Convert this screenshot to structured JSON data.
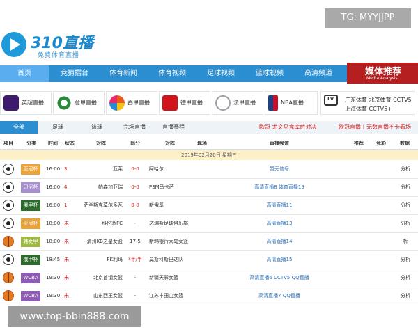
{
  "watermarks": {
    "top": "TG: MYYJJPP",
    "bottom": "www.top-bbin888.com"
  },
  "logo": {
    "title": "310直播",
    "subtitle": "免费体育直播"
  },
  "nav": {
    "items": [
      "首页",
      "竞猜擂台",
      "体育新闻",
      "体育视频",
      "足球视频",
      "篮球视频",
      "高清频道"
    ],
    "badge_title": "媒体推荐",
    "badge_sub": "Media Analysis"
  },
  "leagues": [
    {
      "label": "英超直播",
      "icon": "premier-league-icon",
      "color": "#3d1a6e"
    },
    {
      "label": "意甲直播",
      "icon": "serie-a-icon",
      "color": "#2a8a3a"
    },
    {
      "label": "西甲直播",
      "icon": "laliga-icon",
      "color": "#e85a1a"
    },
    {
      "label": "德甲直播",
      "icon": "bundesliga-icon",
      "color": "#d0141e"
    },
    {
      "label": "法甲直播",
      "icon": "ligue1-icon",
      "color": "#9aa0a6"
    },
    {
      "label": "NBA直播",
      "icon": "nba-icon",
      "color": "#1d428a"
    }
  ],
  "tv": {
    "icon_text": "TV",
    "line1": "广东体育 北京体育 CCTV5",
    "line2": "上海体育 CCTV5+"
  },
  "tabs": [
    "全部",
    "足球",
    "篮球",
    "完场直播",
    "直播赛程"
  ],
  "notices": [
    "欧冠 尤文马竞库萨对决",
    "欧冠直播丨无数直播不卡看场"
  ],
  "headers": [
    "项目",
    "分类",
    "时间",
    "状态",
    "对阵",
    "比分",
    "对阵",
    "现场",
    "直播频道",
    "推荐",
    "竞彩",
    "数据"
  ],
  "date_row": "2019年02月20日 星期三",
  "rows": [
    {
      "sport": "soccer",
      "league": "亚冠杯",
      "league_color": "#e8a33a",
      "time": "16:00",
      "status": "3'",
      "home": "亚莱",
      "score": "0-0",
      "away": "阿哈尔",
      "half": "",
      "channels": "暂无信号",
      "data": "分析"
    },
    {
      "sport": "soccer",
      "league": "印尼杯",
      "league_color": "#a78fd0",
      "time": "16:00",
      "status": "4'",
      "home": "帕森加亚瑞",
      "score": "0-0",
      "away": "PSM马卡萨",
      "half": "",
      "channels": "高清直播8  体育直播19",
      "data": "分析"
    },
    {
      "sport": "soccer",
      "league": "俄甲杯",
      "league_color": "#2d6b2d",
      "time": "16:00",
      "status": "1'",
      "home": "萨兰斯克莫尔多瓦",
      "score": "0-0",
      "away": "新俄基",
      "half": "",
      "channels": "高清直播11",
      "data": "分析"
    },
    {
      "sport": "soccer",
      "league": "亚冠杯",
      "league_color": "#e8a33a",
      "time": "18:00",
      "status": "未",
      "home": "科伦塞FC",
      "score": "-",
      "away": "达瑞斯足球俱乐部",
      "half": "",
      "channels": "高清直播13",
      "data": "分析"
    },
    {
      "sport": "basket",
      "league": "韩女甲",
      "league_color": "#9fb845",
      "time": "18:00",
      "status": "未",
      "home": "清州KB之星女篮",
      "score": "-",
      "away": "新韩银行大岛女篮",
      "half": "17.5",
      "channels": "高清直播14",
      "data": "析"
    },
    {
      "sport": "soccer",
      "league": "俄甲杯",
      "league_color": "#2d6b2d",
      "time": "18:45",
      "status": "未",
      "home": "FK利玛",
      "score": "*半/半",
      "away": "莫斯科斯巴达队",
      "half": "",
      "channels": "高清直播15",
      "data": "分析"
    },
    {
      "sport": "basket",
      "league": "WCBA",
      "league_color": "#8e5bb5",
      "time": "19:30",
      "status": "未",
      "home": "北京首钢女篮",
      "score": "-",
      "away": "新疆天彩女篮",
      "half": "",
      "channels": "高清直播6  CCTV5  QQ直播",
      "data": "分析"
    },
    {
      "sport": "basket",
      "league": "WCBA",
      "league_color": "#8e5bb5",
      "time": "19:30",
      "status": "未",
      "home": "山东西王女篮",
      "score": "-",
      "away": "江苏丰田山女篮",
      "half": "",
      "channels": "高清直播7  QQ直播",
      "data": "分析"
    }
  ],
  "colors": {
    "nav": "#2b8ed1",
    "badge": "#b51f1f",
    "notice": "#d02020",
    "date_bg": "#fbf0c8"
  }
}
